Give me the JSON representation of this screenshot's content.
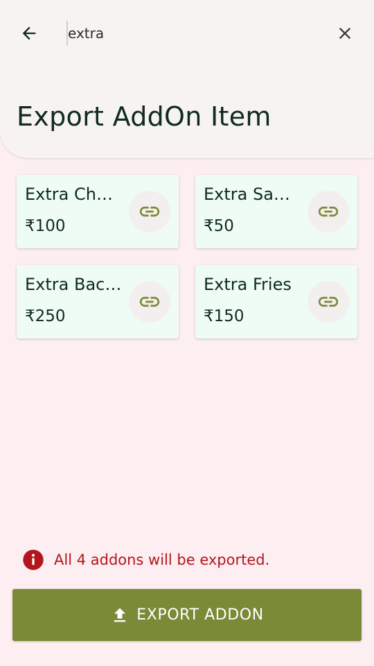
{
  "colors": {
    "background": "#fdeef2",
    "header": "#f8f3f3",
    "card": "#effcf6",
    "accent": "#7a8a36",
    "error": "#b3151c",
    "text": "#0f2a1e"
  },
  "header": {
    "back_icon": "arrow-left-icon",
    "search": {
      "value": "extra",
      "placeholder": ""
    },
    "close_icon": "close-icon",
    "title": "Export AddOn Item"
  },
  "addons": [
    {
      "name": "Extra Cheese",
      "price": "₹100",
      "icon": "link-icon"
    },
    {
      "name": "Extra Sauce",
      "price": "₹50",
      "icon": "link-icon"
    },
    {
      "name": "Extra Bacon",
      "price": "₹250",
      "icon": "link-icon"
    },
    {
      "name": "Extra Fries",
      "price": "₹150",
      "icon": "link-icon"
    }
  ],
  "notice": {
    "icon": "info-error-icon",
    "text": "All 4 addons will be exported."
  },
  "export_button": {
    "icon": "upload-icon",
    "label": "EXPORT ADDON"
  }
}
